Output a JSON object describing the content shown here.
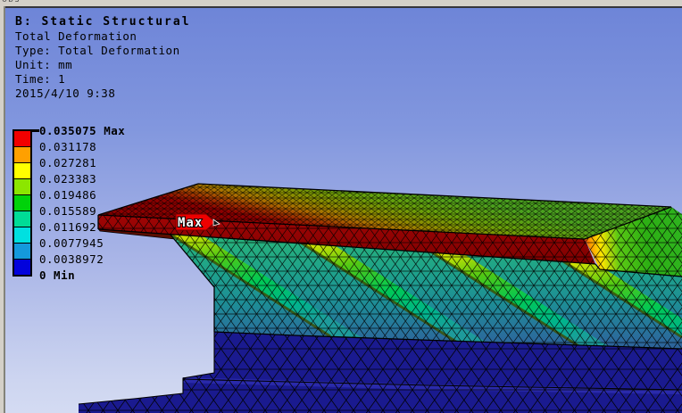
{
  "window": {
    "clipped_top_text": "obs"
  },
  "annotation": {
    "title": "B: Static Structural",
    "lines": [
      "Total Deformation",
      "Type: Total Deformation",
      "Unit: mm",
      "Time: 1",
      "2015/4/10 9:38"
    ]
  },
  "legend": {
    "colors": [
      "#f20000",
      "#ffa000",
      "#ffff00",
      "#8ce600",
      "#00d20a",
      "#00dc96",
      "#00e0e0",
      "#1499dc",
      "#0202dc"
    ],
    "entries": [
      {
        "label": "0.035075 Max"
      },
      {
        "label": "0.031178"
      },
      {
        "label": "0.027281"
      },
      {
        "label": "0.023383"
      },
      {
        "label": "0.019486"
      },
      {
        "label": "0.015589"
      },
      {
        "label": "0.011692"
      },
      {
        "label": "0.0077945"
      },
      {
        "label": "0.0038972"
      },
      {
        "label": "0 Min"
      }
    ]
  },
  "max_marker": {
    "label": "Max"
  }
}
